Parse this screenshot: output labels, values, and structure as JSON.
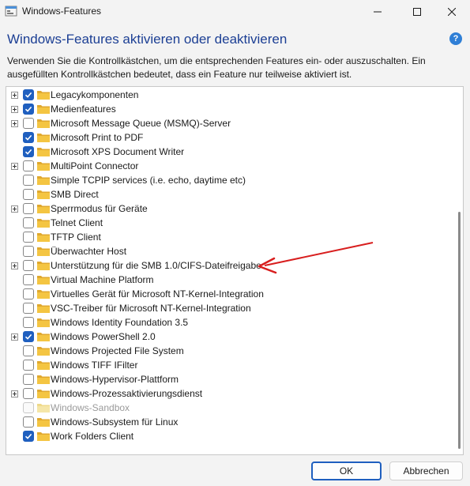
{
  "window": {
    "title": "Windows-Features",
    "heading": "Windows-Features aktivieren oder deaktivieren",
    "description": "Verwenden Sie die Kontrollkästchen, um die entsprechenden Features ein- oder auszuschalten. Ein ausgefüllten Kontrollkästchen bedeutet, dass ein Feature nur teilweise aktiviert ist.",
    "help_icon": "?"
  },
  "features": [
    {
      "label": "Legacykomponenten",
      "checked": true,
      "expandable": true,
      "disabled": false
    },
    {
      "label": "Medienfeatures",
      "checked": true,
      "expandable": true,
      "disabled": false
    },
    {
      "label": "Microsoft Message Queue (MSMQ)-Server",
      "checked": false,
      "expandable": true,
      "disabled": false
    },
    {
      "label": "Microsoft Print to PDF",
      "checked": true,
      "expandable": false,
      "disabled": false
    },
    {
      "label": "Microsoft XPS Document Writer",
      "checked": true,
      "expandable": false,
      "disabled": false
    },
    {
      "label": "MultiPoint Connector",
      "checked": false,
      "expandable": true,
      "disabled": false
    },
    {
      "label": "Simple TCPIP services (i.e. echo, daytime etc)",
      "checked": false,
      "expandable": false,
      "disabled": false
    },
    {
      "label": "SMB Direct",
      "checked": false,
      "expandable": false,
      "disabled": false
    },
    {
      "label": "Sperrmodus für Geräte",
      "checked": false,
      "expandable": true,
      "disabled": false
    },
    {
      "label": "Telnet Client",
      "checked": false,
      "expandable": false,
      "disabled": false
    },
    {
      "label": "TFTP Client",
      "checked": false,
      "expandable": false,
      "disabled": false
    },
    {
      "label": "Überwachter Host",
      "checked": false,
      "expandable": false,
      "disabled": false
    },
    {
      "label": "Unterstützung für die SMB 1.0/CIFS-Dateifreigabe",
      "checked": false,
      "expandable": true,
      "disabled": false
    },
    {
      "label": "Virtual Machine Platform",
      "checked": false,
      "expandable": false,
      "disabled": false
    },
    {
      "label": "Virtuelles Gerät für Microsoft NT-Kernel-Integration",
      "checked": false,
      "expandable": false,
      "disabled": false
    },
    {
      "label": "VSC-Treiber für Microsoft NT-Kernel-Integration",
      "checked": false,
      "expandable": false,
      "disabled": false
    },
    {
      "label": "Windows Identity Foundation 3.5",
      "checked": false,
      "expandable": false,
      "disabled": false
    },
    {
      "label": "Windows PowerShell 2.0",
      "checked": true,
      "expandable": true,
      "disabled": false
    },
    {
      "label": "Windows Projected File System",
      "checked": false,
      "expandable": false,
      "disabled": false
    },
    {
      "label": "Windows TIFF IFilter",
      "checked": false,
      "expandable": false,
      "disabled": false
    },
    {
      "label": "Windows-Hypervisor-Plattform",
      "checked": false,
      "expandable": false,
      "disabled": false
    },
    {
      "label": "Windows-Prozessaktivierungsdienst",
      "checked": false,
      "expandable": true,
      "disabled": false
    },
    {
      "label": "Windows-Sandbox",
      "checked": false,
      "expandable": false,
      "disabled": true
    },
    {
      "label": "Windows-Subsystem für Linux",
      "checked": false,
      "expandable": false,
      "disabled": false
    },
    {
      "label": "Work Folders Client",
      "checked": true,
      "expandable": false,
      "disabled": false
    }
  ],
  "buttons": {
    "ok": "OK",
    "cancel": "Abbrechen"
  },
  "colors": {
    "accent": "#1f5fbf",
    "heading": "#1c3f94",
    "folder": "#f4c542",
    "annotation_arrow": "#d81e1e"
  }
}
